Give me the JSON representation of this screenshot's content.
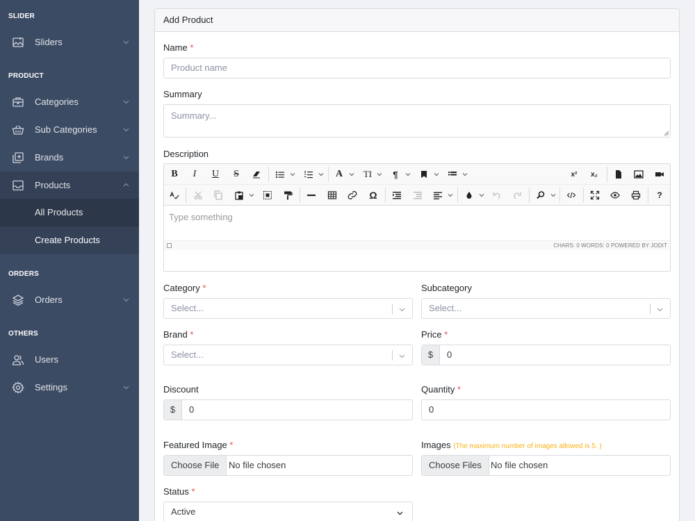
{
  "sidebar": {
    "sections": {
      "slider": "SLIDER",
      "product": "PRODUCT",
      "orders": "ORDERS",
      "others": "OTHERS"
    },
    "items": {
      "sliders": "Sliders",
      "categories": "Categories",
      "sub_categories": "Sub Categories",
      "brands": "Brands",
      "products": "Products",
      "all_products": "All Products",
      "create_products": "Create Products",
      "orders": "Orders",
      "users": "Users",
      "settings": "Settings"
    }
  },
  "card": {
    "title": "Add Product"
  },
  "form": {
    "required_mark": "*",
    "name": {
      "label": "Name",
      "placeholder": "Product name"
    },
    "summary": {
      "label": "Summary",
      "placeholder": "Summary..."
    },
    "description": {
      "label": "Description",
      "placeholder": "Type something",
      "status": "CHARS: 0   WORDS: 0   POWERED BY JODIT",
      "toolbar_text": {
        "bold": "B",
        "italic": "I",
        "underline": "U",
        "strike": "S",
        "font": "A",
        "size": "TI",
        "paragraph": "¶",
        "omega": "Ω",
        "help": "?"
      }
    },
    "category": {
      "label": "Category",
      "placeholder": "Select..."
    },
    "subcategory": {
      "label": "Subcategory",
      "placeholder": "Select..."
    },
    "brand": {
      "label": "Brand",
      "placeholder": "Select..."
    },
    "price": {
      "label": "Price",
      "currency": "$",
      "value": "0"
    },
    "discount": {
      "label": "Discount",
      "currency": "$",
      "value": "0"
    },
    "quantity": {
      "label": "Quantity",
      "value": "0"
    },
    "featured_image": {
      "label": "Featured Image",
      "button": "Choose File",
      "filename": "No file chosen"
    },
    "images": {
      "label": "Images",
      "hint": "(The maximum number of images allowed is 5. )",
      "button": "Choose Files",
      "filename": "No file chosen"
    },
    "status": {
      "label": "Status",
      "value": "Active"
    }
  },
  "colors": {
    "sidebar": "#3c4b64",
    "required": "#e55353",
    "hint": "#f9b115"
  }
}
